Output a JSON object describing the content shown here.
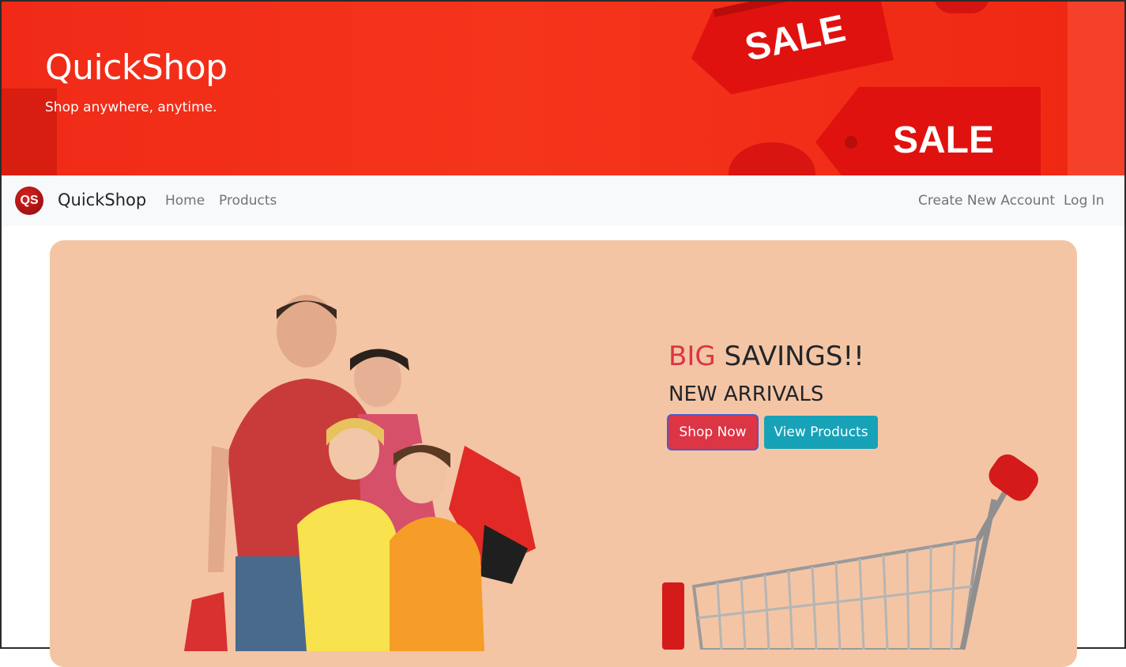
{
  "banner": {
    "title": "QuickShop",
    "tagline": "Shop anywhere, anytime.",
    "tags": [
      "SALE",
      "SALE"
    ],
    "colors": {
      "background": "#f02a17",
      "tag": "#e0120f"
    }
  },
  "navbar": {
    "logo_text": "QS",
    "brand": "QuickShop",
    "links": [
      "Home",
      "Products"
    ],
    "right_links": [
      "Create New Account",
      "Log In"
    ]
  },
  "promo": {
    "headline_accent": "BIG",
    "headline_rest": "SAVINGS!!",
    "subheadline": "NEW ARRIVALS",
    "buttons": {
      "shop_now": "Shop Now",
      "view_products": "View Products"
    },
    "colors": {
      "card": "#f4c5a4",
      "accent": "#dc3545",
      "info": "#17a2b8"
    },
    "images": [
      "family-shopping-photo",
      "shopping-cart-photo"
    ]
  }
}
